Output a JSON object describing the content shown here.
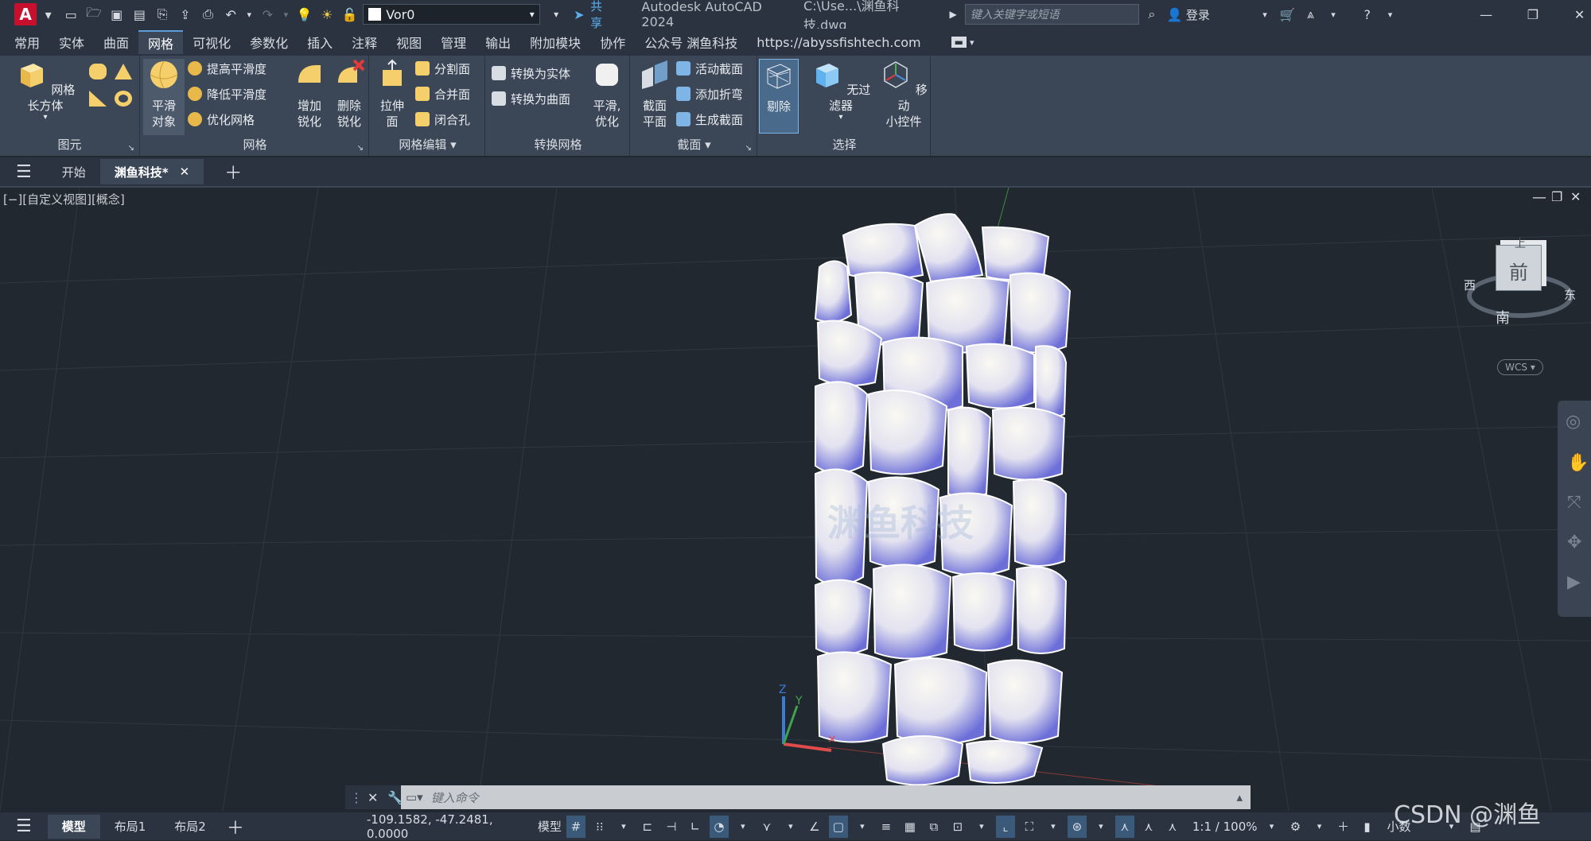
{
  "titlebar": {
    "logo": "A",
    "layer": "Vor0",
    "share": "共享",
    "app_title": "Autodesk AutoCAD 2024",
    "file_path": "C:\\Use...\\渊鱼科技.dwg",
    "search_placeholder": "键入关键字或短语",
    "login": "登录"
  },
  "menu_tabs": [
    "常用",
    "实体",
    "曲面",
    "网格",
    "可视化",
    "参数化",
    "插入",
    "注释",
    "视图",
    "管理",
    "输出",
    "附加模块",
    "协作",
    "公众号 渊鱼科技",
    "https://abyssfishtech.com"
  ],
  "active_menu_tab": "网格",
  "ribbon": {
    "primitives": {
      "title": "图元",
      "mesh_box": "网格长方体"
    },
    "mesh": {
      "title": "网格",
      "smooth_object": "平滑\n对象",
      "smooth_more": "提高平滑度",
      "smooth_less": "降低平滑度",
      "refine": "优化网格"
    },
    "edit": {
      "title": "网格编辑",
      "add_crease": "增加\n锐化",
      "remove_crease": "删除\n锐化",
      "extrude": "拉伸\n面",
      "split": "分割面",
      "merge": "合并面",
      "close_hole": "闭合孔"
    },
    "convert": {
      "title": "转换网格",
      "to_solid": "转换为实体",
      "to_surface": "转换为曲面",
      "smooth_opt": "平滑,\n优化"
    },
    "section": {
      "title": "截面",
      "plane": "截面\n平面",
      "live": "活动截面",
      "jog": "添加折弯",
      "generate": "生成截面"
    },
    "selection": {
      "title": "选择",
      "cull": "剔除",
      "no_filter": "无过滤器",
      "gizmo": "移动\n小控件"
    }
  },
  "doc_tabs": {
    "start": "开始",
    "active": "渊鱼科技*"
  },
  "viewport": {
    "label": "[−][自定义视图][概念]",
    "viewcube": {
      "top": "上",
      "front": "前",
      "west": "西",
      "east": "东",
      "south": "南",
      "wcs": "WCS"
    },
    "watermark": "渊鱼科技",
    "ucs_z": "Z",
    "ucs_y": "Y"
  },
  "command": {
    "placeholder": "键入命令"
  },
  "status": {
    "tabs": [
      "模型",
      "布局1",
      "布局2"
    ],
    "coords": "-109.1582, -47.2481, 0.0000",
    "model": "模型",
    "scale": "1:1 / 100%",
    "units": "小数",
    "csdn": "CSDN @渊鱼"
  },
  "colors": {
    "bg": "#212830",
    "bar": "#2b3340",
    "ribbon": "#3b4656",
    "stone_light": "#f3f1ea",
    "stone_shadow": "#6d6fd8"
  }
}
